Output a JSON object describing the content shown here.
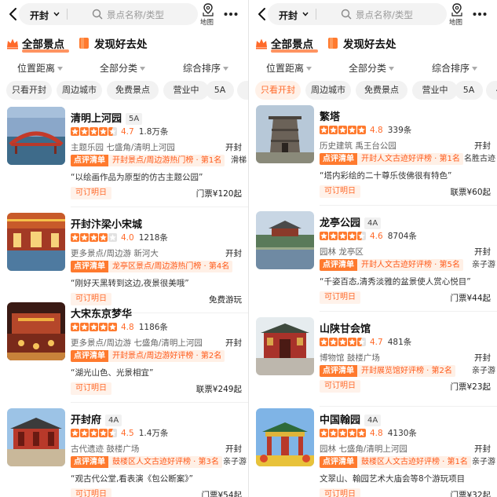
{
  "left": {
    "header": {
      "city": "开封",
      "search_placeholder": "景点名称/类型",
      "map_label": "地图"
    },
    "tabs": [
      {
        "label": "全部景点",
        "active": true
      },
      {
        "label": "发现好去处",
        "active": false
      }
    ],
    "filters": [
      "位置距离",
      "全部分类",
      "综合排序"
    ],
    "chips": [
      {
        "label": "只看开封",
        "active": false
      },
      {
        "label": "周边城市",
        "active": false
      },
      {
        "label": "免费景点",
        "active": false
      },
      {
        "label": "营业中",
        "active": false
      },
      {
        "label": "5A",
        "active": false
      },
      {
        "label": "4",
        "active": false
      }
    ],
    "cards": [
      {
        "name": "清明上河园",
        "level": "5A",
        "rating": 4.7,
        "score": "4.7",
        "reviews": "1.8万条",
        "tags": "主题乐园  七盛角/清明上河园",
        "status": "开封",
        "rank_head": "点评清单",
        "rank_text": "开封景点/周边游热门榜 · 第1名",
        "feature": "滑梯",
        "quote": "“以绘画作品为原型的仿古主题公园”",
        "book": "可订明日",
        "price": "门票¥120起"
      },
      {
        "name": "开封汴梁小宋城",
        "level": "",
        "rating": 4.0,
        "score": "4.0",
        "reviews": "1218条",
        "tags": "更多景点/周边游  新河大",
        "status": "开封",
        "rank_head": "点评清单",
        "rank_text": "龙亭区景点/周边游热门榜 · 第4名",
        "feature": "",
        "quote": "“刚好天黑转到这边,夜景很美哦”",
        "book": "可订明日",
        "price": "免费游玩"
      },
      {
        "name": "大宋东京梦华",
        "level": "",
        "rating": 4.8,
        "score": "4.8",
        "reviews": "1186条",
        "tags": "更多景点/周边游  七盛角/清明上河园",
        "status": "开封",
        "rank_head": "点评清单",
        "rank_text": "开封景点/周边游好评榜 · 第2名",
        "feature": "",
        "quote": "“湖光山色、光景相宜”",
        "book": "可订明日",
        "price": "联票¥249起"
      },
      {
        "name": "开封府",
        "level": "4A",
        "rating": 4.5,
        "score": "4.5",
        "reviews": "1.4万条",
        "tags": "古代遗迹  鼓楼广场",
        "status": "开封",
        "rank_head": "点评清单",
        "rank_text": "鼓楼区人文古迹好评榜 · 第3名",
        "feature": "亲子游",
        "quote": "“观古代公堂,看表演《包公断案》”",
        "book": "可订明日",
        "price": "门票¥54起"
      }
    ]
  },
  "right": {
    "header": {
      "city": "开封",
      "search_placeholder": "景点名称/类型",
      "map_label": "地图"
    },
    "tabs": [
      {
        "label": "全部景点",
        "active": true
      },
      {
        "label": "发现好去处",
        "active": false
      }
    ],
    "filters": [
      "位置距离",
      "全部分类",
      "综合排序"
    ],
    "chips": [
      {
        "label": "只看开封",
        "active": true
      },
      {
        "label": "周边城市",
        "active": false
      },
      {
        "label": "免费景点",
        "active": false
      },
      {
        "label": "营业中",
        "active": false
      },
      {
        "label": "5A",
        "active": false
      },
      {
        "label": "4A",
        "active": false
      }
    ],
    "cards": [
      {
        "name": "繁塔",
        "level": "",
        "rating": 4.8,
        "score": "4.8",
        "reviews": "339条",
        "tags": "历史建筑  禹王台公园",
        "status": "开封",
        "rank_head": "点评清单",
        "rank_text": "开封人文古迹好评榜 · 第1名",
        "feature": "名胜古迹",
        "quote": "“塔内彩绘的二十尊乐伎佛很有特色”",
        "book": "可订明日",
        "price": "联票¥60起"
      },
      {
        "name": "龙亭公园",
        "level": "4A",
        "rating": 4.6,
        "score": "4.6",
        "reviews": "8704条",
        "tags": "园林  龙亭区",
        "status": "开封",
        "rank_head": "点评清单",
        "rank_text": "开封人文古迹好评榜 · 第5名",
        "feature": "亲子游",
        "quote": "“千姿百态,清秀淡雅的盆景使人赏心悦目”",
        "book": "可订明日",
        "price": "门票¥44起"
      },
      {
        "name": "山陕甘会馆",
        "level": "",
        "rating": 4.7,
        "score": "4.7",
        "reviews": "481条",
        "tags": "博物馆  鼓楼广场",
        "status": "开封",
        "rank_head": "点评清单",
        "rank_text": "开封展览馆好评榜 · 第2名",
        "feature": "亲子游",
        "quote": "",
        "book": "可订明日",
        "price": "门票¥23起"
      },
      {
        "name": "中国翰园",
        "level": "4A",
        "rating": 4.8,
        "score": "4.8",
        "reviews": "4130条",
        "tags": "园林  七盛角/清明上河园",
        "status": "开封",
        "rank_head": "点评清单",
        "rank_text": "鼓楼区人文古迹好评榜 · 第1名",
        "feature": "亲子游",
        "quote": "文翠山、翰园艺术大庙会等8个游玩项目",
        "book": "可订明日",
        "price": "门票¥32起"
      }
    ]
  },
  "colors": {
    "accent": "#ff6a2a",
    "star": "#ff7a2e",
    "rank_bg": "#fff0e6",
    "chip_bg": "#f2f2f2"
  }
}
